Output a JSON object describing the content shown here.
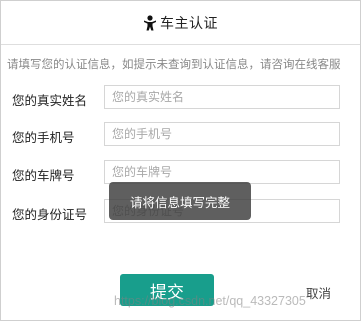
{
  "header": {
    "title": "车主认证",
    "icon": "person-icon"
  },
  "notice": "请填写您的认证信息，如提示未查询到认证信息，请咨询在线客服",
  "form": {
    "fields": [
      {
        "label": "您的真实姓名",
        "placeholder": "您的真实姓名",
        "value": ""
      },
      {
        "label": "您的手机号",
        "placeholder": "您的手机号",
        "value": ""
      },
      {
        "label": "您的车牌号",
        "placeholder": "您的车牌号",
        "value": ""
      },
      {
        "label": "您的身份证号",
        "placeholder": "您的身份证号",
        "value": ""
      }
    ]
  },
  "toast": "请将信息填写完整",
  "actions": {
    "submit_label": "提交",
    "cancel_label": "取消"
  },
  "watermark": "https://blog.csdn.net/qq_43327305",
  "colors": {
    "accent": "#189e8c",
    "toast_bg": "#3c3c3c"
  }
}
